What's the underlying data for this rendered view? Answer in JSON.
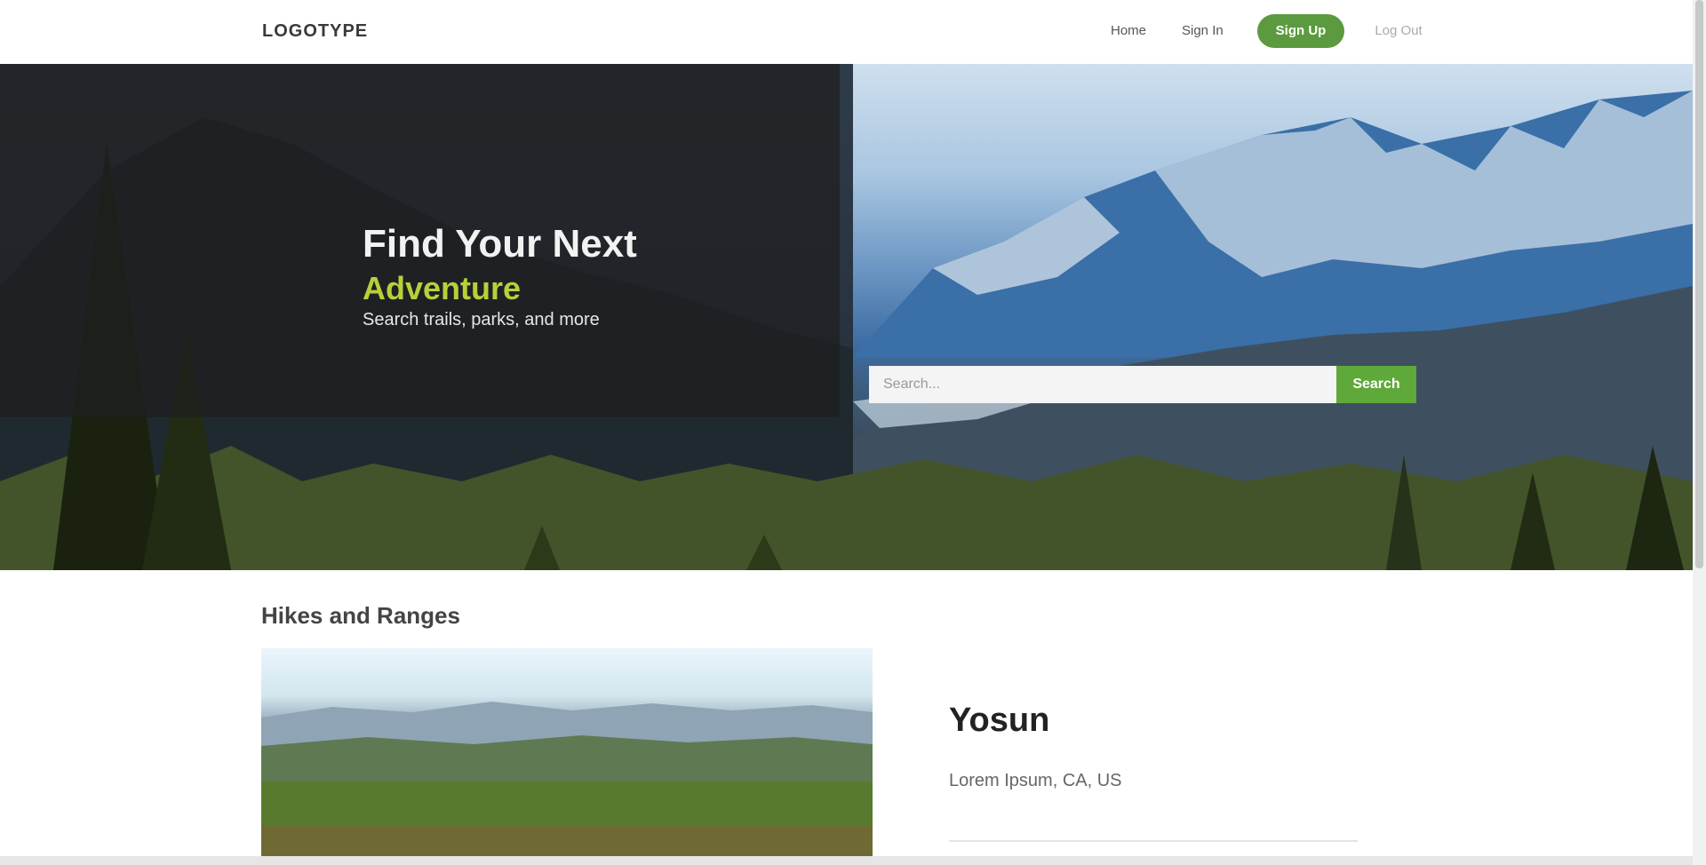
{
  "header": {
    "logo": "LOGOTYPE",
    "nav": {
      "home_label": "Home",
      "login_label": "Sign In",
      "signup_label": "Sign Up",
      "logout_label": "Log Out"
    }
  },
  "hero": {
    "title": "Find Your Next",
    "highlight": "Adventure",
    "subtitle": "Search trails, parks, and more",
    "search": {
      "placeholder": "Search...",
      "value": "",
      "button_label": "Search"
    }
  },
  "content": {
    "section_title": "Hikes and Ranges",
    "card": {
      "title": "Yosun",
      "location": "Lorem Ipsum, CA, US"
    }
  },
  "colors": {
    "accent_green": "#5b9a3e",
    "highlight_yellow": "#b9cf3b",
    "overlay": "#1e1e1e"
  },
  "icons": []
}
